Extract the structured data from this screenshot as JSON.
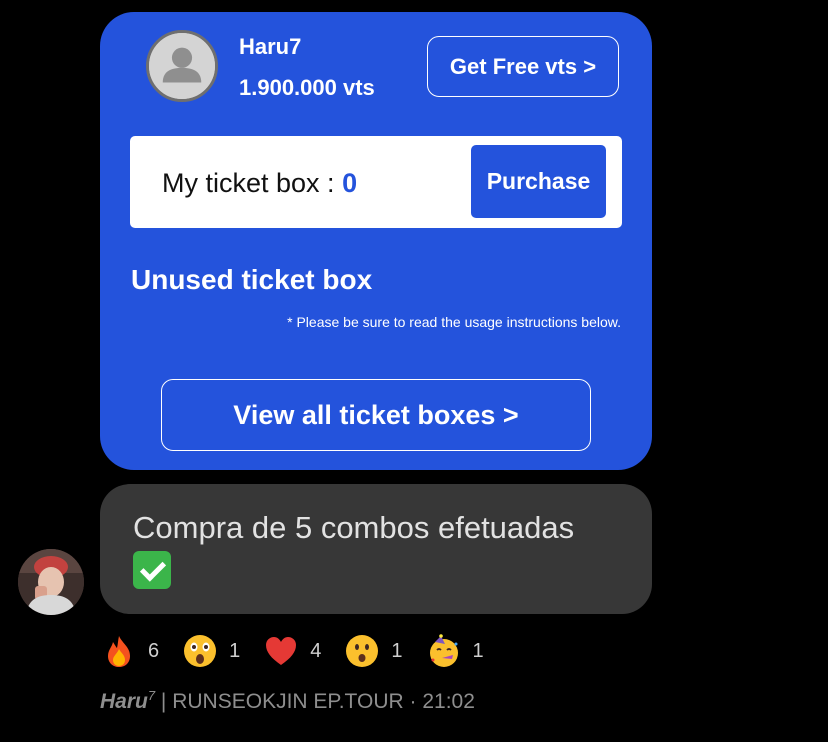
{
  "profile": {
    "username": "Haru7",
    "balance": "1.900.000 vts",
    "free_votes_label": "Get Free vts >",
    "avatar_icon": "user-silhouette-icon"
  },
  "ticket_box": {
    "label": "My ticket box : ",
    "count": "0",
    "purchase_label": "Purchase"
  },
  "unused": {
    "title": "Unused ticket box",
    "note": "* Please be sure to read the usage instructions below.",
    "view_all_label": "View all ticket boxes >"
  },
  "message": {
    "text": "Compra de 5 combos efetuadas",
    "emoji": "check-mark-button-icon"
  },
  "reactions": [
    {
      "icon": "fire-icon",
      "count": "6"
    },
    {
      "icon": "astonished-face-icon",
      "count": "1"
    },
    {
      "icon": "red-heart-icon",
      "count": "4"
    },
    {
      "icon": "hushed-face-icon",
      "count": "1"
    },
    {
      "icon": "partying-face-icon",
      "count": "1"
    }
  ],
  "footer": {
    "author": "Haru",
    "author_sup": "7",
    "channel": " | RUNSEOKJIN EP.TOUR",
    "time": " · 21:02"
  },
  "colors": {
    "card_blue": "#2453dc",
    "bubble_gray": "#373737",
    "background": "#000000"
  }
}
